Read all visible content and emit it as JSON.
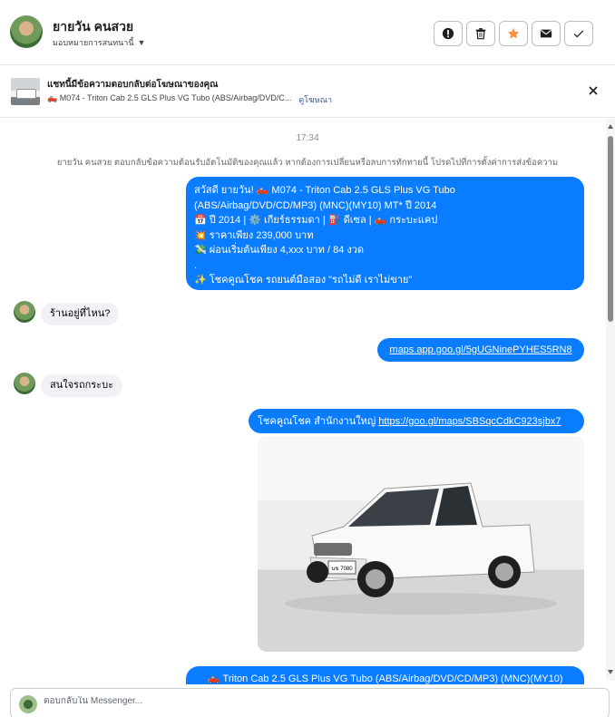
{
  "header": {
    "contact_name": "ยายวัน คนสวย",
    "assign_label": "มอบหมายการสนทนานี้",
    "actions": [
      {
        "name": "mark-spam-button",
        "icon": "exclamation-icon"
      },
      {
        "name": "delete-button",
        "icon": "trash-icon"
      },
      {
        "name": "star-button",
        "icon": "star-icon",
        "color": "#f7923b"
      },
      {
        "name": "mark-unread-button",
        "icon": "envelope-icon"
      },
      {
        "name": "mark-done-button",
        "icon": "check-icon"
      }
    ]
  },
  "ad_reference": {
    "title": "แชทนี้มีข้อความตอบกลับต่อโฆษณาของคุณ",
    "ad_name": "🛻 M074 - Triton Cab 2.5 GLS Plus VG Tubo (ABS/Airbag/DVD/C...",
    "view_ad_link": "ดูโฆษณา"
  },
  "conversation": {
    "timestamp": "17:34",
    "auto_reply_notice": "ยายวัน คนสวย ตอบกลับข้อความต้อนรับอัตโนมัติของคุณแล้ว หากต้องการเปลี่ยนหรือลบการทักทายนี้ โปรดไปที่การตั้งค่าการส่งข้อความ",
    "messages": [
      {
        "direction": "outgoing",
        "lines": [
          "สวัสดี ยายวัน! 🛻 M074 - Triton Cab 2.5 GLS Plus VG Tubo",
          "(ABS/Airbag/DVD/CD/MP3) (MNC)(MY10) MT* ปี 2014",
          "📅 ปี 2014 | ⚙️ เกียร์ธรรมดา | ⛽ ดีเซล | 🛻 กระบะแคป",
          "💥 ราคาเพียง 239,000 บาท",
          "💸 ผ่อนเริ่มต้นเพียง 4,xxx บาท / 84 งวด",
          ".",
          "✨ โชคคูณโชค รถยนต์มือสอง \"รถไม่ดี เราไม่ขาย\""
        ]
      },
      {
        "direction": "incoming",
        "text": "ร้านอยู่ที่ไหน?"
      },
      {
        "direction": "outgoing",
        "link": "maps.app.goo.gl/5gUGNinePYHES5RN8"
      },
      {
        "direction": "incoming",
        "text": "สนใจรถกระบะ"
      },
      {
        "direction": "outgoing",
        "prefix": "โชคคูณโชค สำนักงานใหญ่ ",
        "link": "https://goo.gl/maps/SBSqcCdkC923sjbx7"
      },
      {
        "direction": "outgoing",
        "type": "image",
        "plate_text": "นข 7080",
        "image_alt": "white Mitsubishi Triton pickup truck"
      },
      {
        "direction": "outgoing",
        "text": "🛻 Triton Cab 2.5 GLS Plus VG Tubo (ABS/Airbag/DVD/CD/MP3) (MNC)(MY10)"
      }
    ]
  },
  "composer": {
    "placeholder": "ตอบกลับใน Messenger..."
  },
  "colors": {
    "outgoing_bubble": "#0a7cff",
    "incoming_bubble": "#f0f2f5",
    "star": "#f7923b"
  }
}
